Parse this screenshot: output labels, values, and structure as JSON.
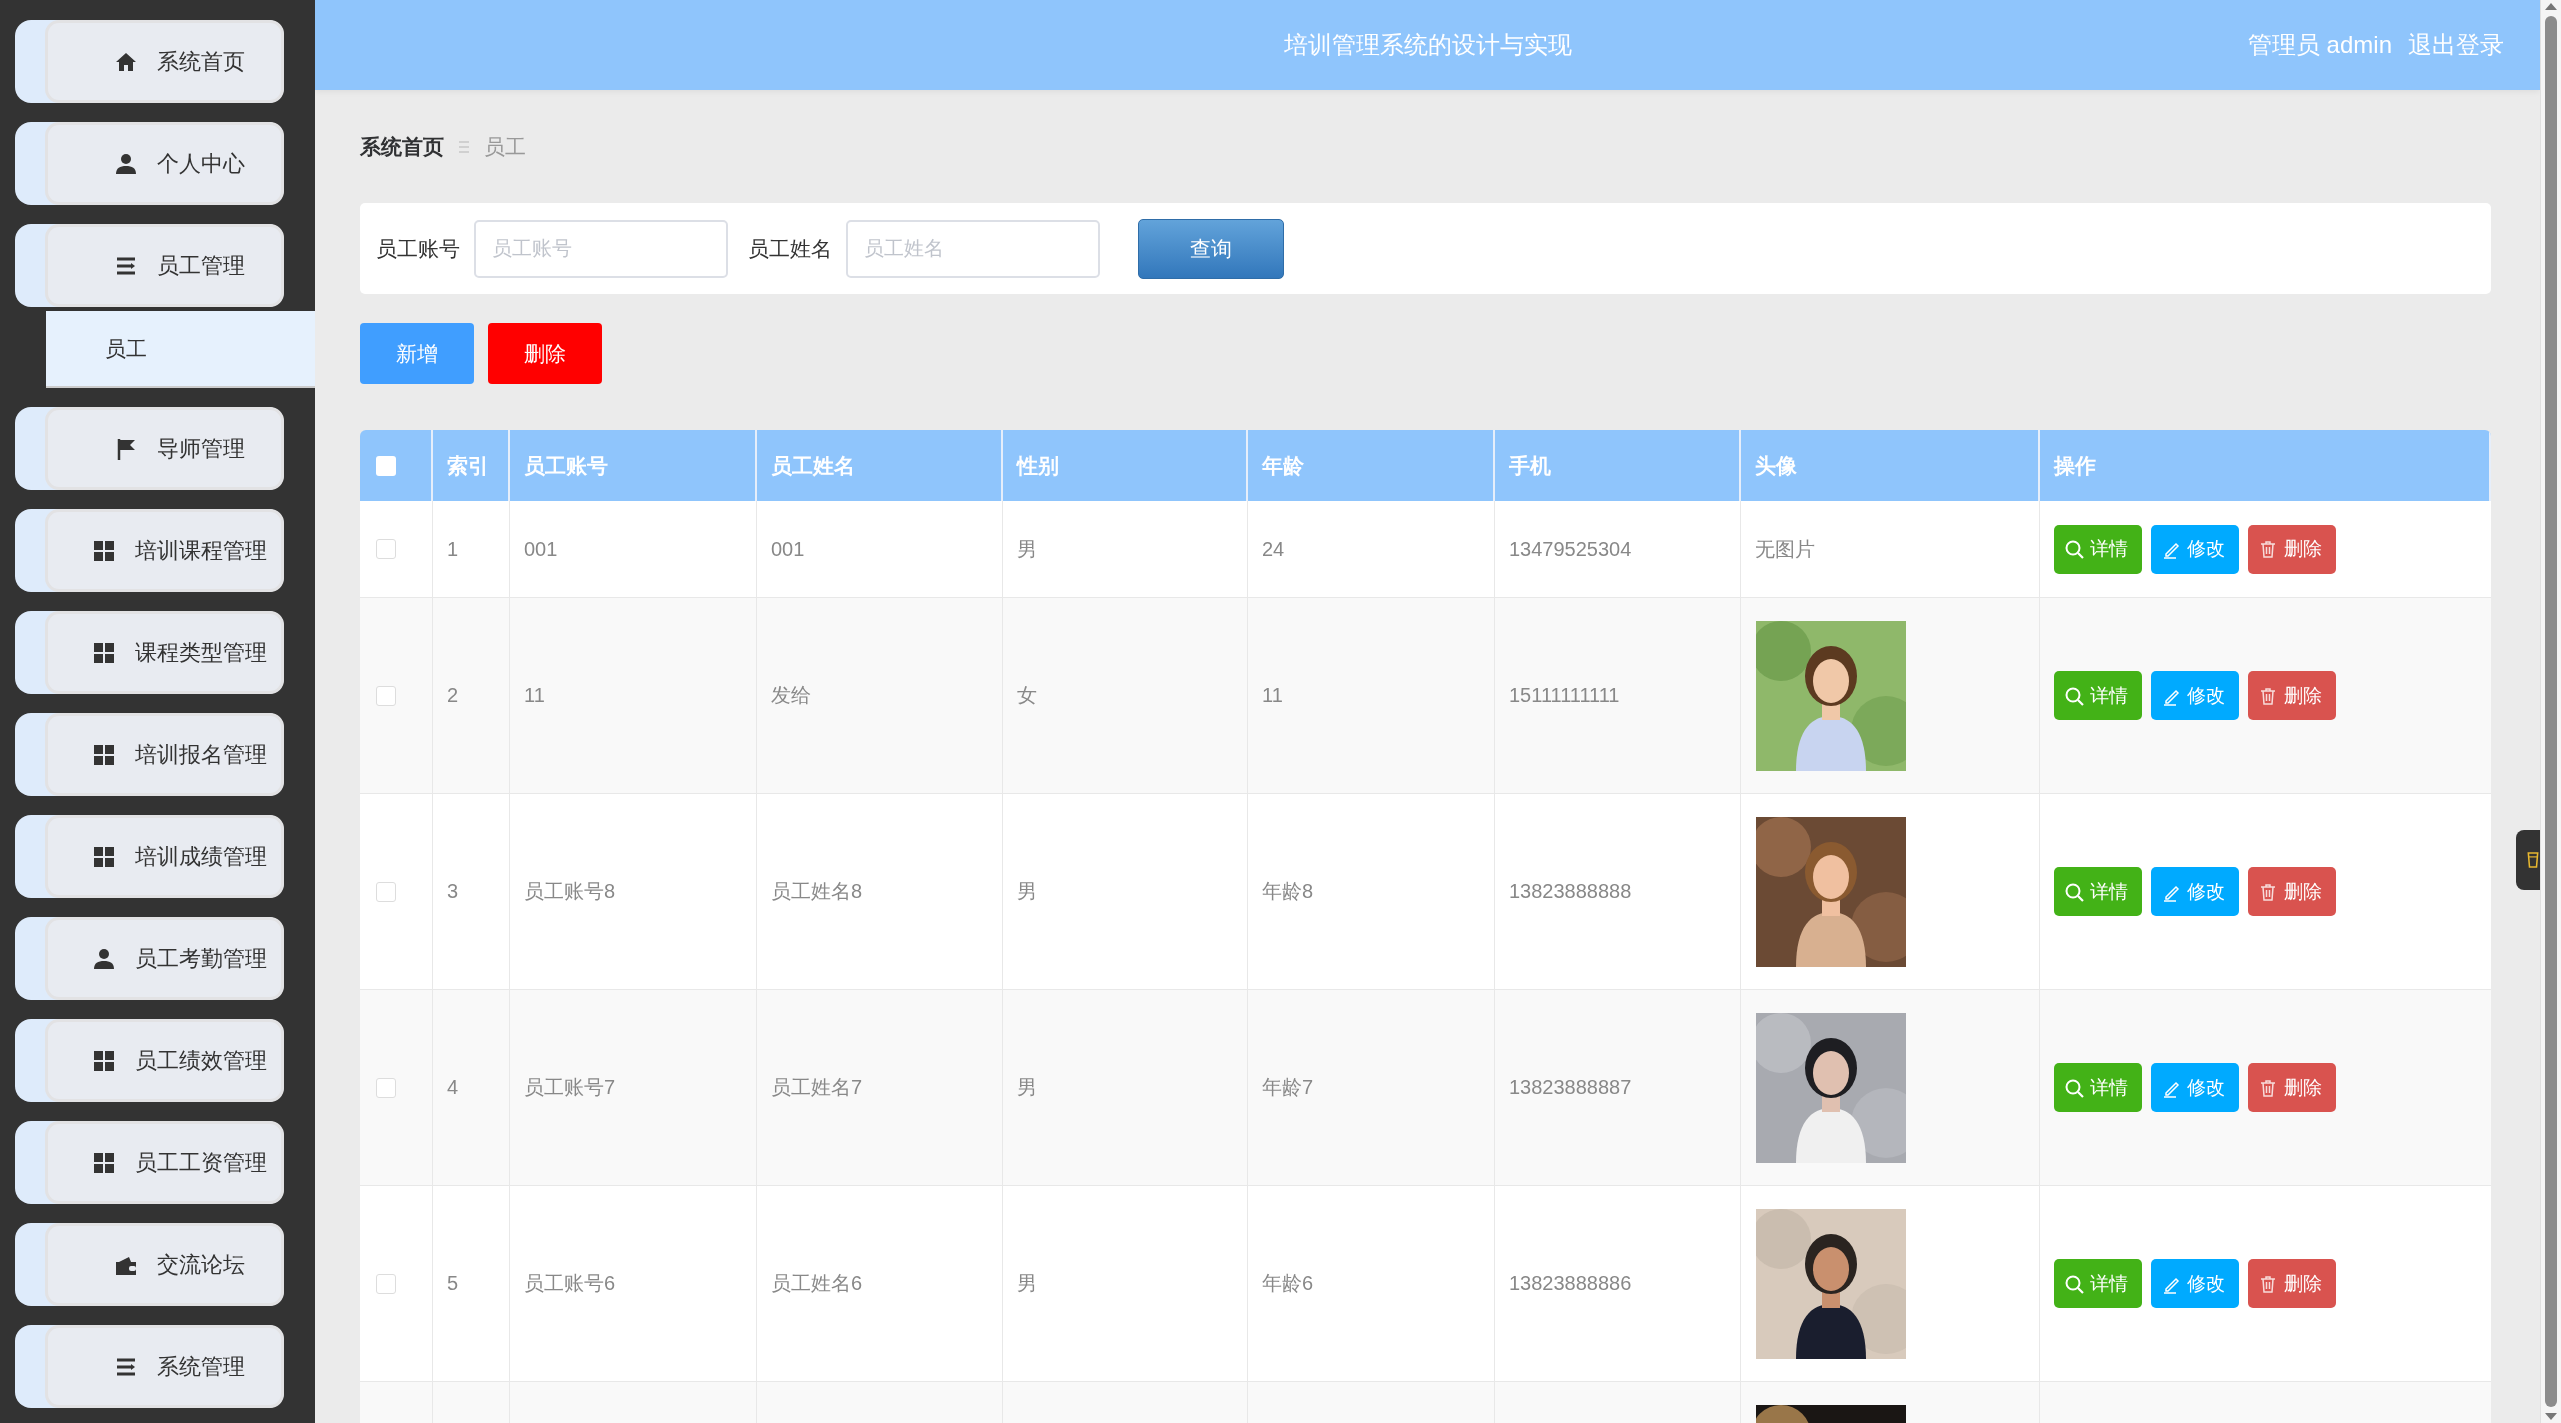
{
  "sidebar": {
    "items": [
      {
        "label": "系统首页"
      },
      {
        "label": "个人中心"
      },
      {
        "label": "员工管理",
        "children": [
          {
            "label": "员工",
            "selected": true
          }
        ]
      },
      {
        "label": "导师管理"
      },
      {
        "label": "培训课程管理"
      },
      {
        "label": "课程类型管理"
      },
      {
        "label": "培训报名管理"
      },
      {
        "label": "培训成绩管理"
      },
      {
        "label": "员工考勤管理"
      },
      {
        "label": "员工绩效管理"
      },
      {
        "label": "员工工资管理"
      },
      {
        "label": "交流论坛"
      },
      {
        "label": "系统管理"
      }
    ]
  },
  "header": {
    "title": "培训管理系统的设计与实现",
    "user": "管理员 admin",
    "logout": "退出登录"
  },
  "breadcrumb": {
    "home": "系统首页",
    "current": "员工"
  },
  "search": {
    "fields": [
      {
        "label": "员工账号",
        "placeholder": "员工账号"
      },
      {
        "label": "员工姓名",
        "placeholder": "员工姓名"
      }
    ],
    "button": "查询"
  },
  "actions": [
    {
      "label": "新增",
      "kind": "add"
    },
    {
      "label": "删除",
      "kind": "delete"
    }
  ],
  "table": {
    "select_all": {
      "checked": false
    },
    "columns": [
      "索引",
      "员工账号",
      "员工姓名",
      "性别",
      "年龄",
      "手机",
      "头像",
      "操作"
    ],
    "rows": [
      {
        "checked": false,
        "cells": [
          "1",
          "001",
          "001",
          "男",
          "24",
          "13479525304"
        ],
        "avatar": {
          "kind": "text",
          "text": "无图片"
        },
        "actions": [
          {
            "label": "详情",
            "kind": "detail"
          },
          {
            "label": "修改",
            "kind": "edit"
          },
          {
            "label": "删除",
            "kind": "delete"
          }
        ]
      },
      {
        "checked": false,
        "cells": [
          "2",
          "11",
          "发给",
          "女",
          "11",
          "15111111111"
        ],
        "avatar": {
          "kind": "picture"
        },
        "actions": [
          {
            "label": "详情",
            "kind": "detail"
          },
          {
            "label": "修改",
            "kind": "edit"
          },
          {
            "label": "删除",
            "kind": "delete"
          }
        ]
      },
      {
        "checked": false,
        "cells": [
          "3",
          "员工账号8",
          "员工姓名8",
          "男",
          "年龄8",
          "13823888888"
        ],
        "avatar": {
          "kind": "picture"
        },
        "actions": [
          {
            "label": "详情",
            "kind": "detail"
          },
          {
            "label": "修改",
            "kind": "edit"
          },
          {
            "label": "删除",
            "kind": "delete"
          }
        ]
      },
      {
        "checked": false,
        "cells": [
          "4",
          "员工账号7",
          "员工姓名7",
          "男",
          "年龄7",
          "13823888887"
        ],
        "avatar": {
          "kind": "picture"
        },
        "actions": [
          {
            "label": "详情",
            "kind": "detail"
          },
          {
            "label": "修改",
            "kind": "edit"
          },
          {
            "label": "删除",
            "kind": "delete"
          }
        ]
      },
      {
        "checked": false,
        "cells": [
          "5",
          "员工账号6",
          "员工姓名6",
          "男",
          "年龄6",
          "13823888886"
        ],
        "avatar": {
          "kind": "picture"
        },
        "actions": [
          {
            "label": "详情",
            "kind": "detail"
          },
          {
            "label": "修改",
            "kind": "edit"
          },
          {
            "label": "删除",
            "kind": "delete"
          }
        ]
      },
      {
        "avatar": {
          "kind": "picture"
        }
      }
    ]
  }
}
